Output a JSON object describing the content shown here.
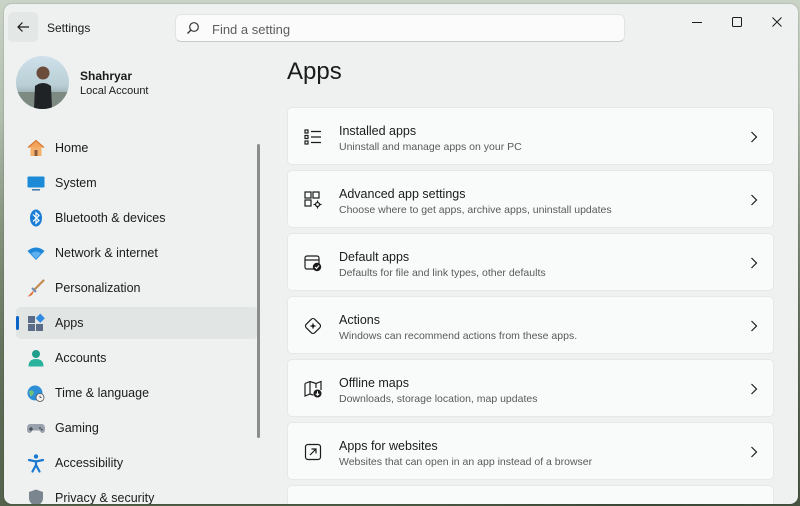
{
  "window": {
    "title": "Settings",
    "search_placeholder": "Find a setting",
    "controls": [
      "minimize-icon",
      "maximize-icon",
      "close-icon"
    ]
  },
  "user": {
    "name": "Shahryar",
    "account_type": "Local Account"
  },
  "sidebar": {
    "items": [
      {
        "label": "Home",
        "icon": "home-icon"
      },
      {
        "label": "System",
        "icon": "system-icon"
      },
      {
        "label": "Bluetooth & devices",
        "icon": "bluetooth-icon"
      },
      {
        "label": "Network & internet",
        "icon": "wifi-icon"
      },
      {
        "label": "Personalization",
        "icon": "brush-icon"
      },
      {
        "label": "Apps",
        "icon": "apps-icon",
        "active": true
      },
      {
        "label": "Accounts",
        "icon": "person-icon"
      },
      {
        "label": "Time & language",
        "icon": "globe-clock-icon"
      },
      {
        "label": "Gaming",
        "icon": "gamepad-icon"
      },
      {
        "label": "Accessibility",
        "icon": "accessibility-icon"
      },
      {
        "label": "Privacy & security",
        "icon": "shield-icon"
      }
    ]
  },
  "main": {
    "title": "Apps",
    "cards": [
      {
        "title": "Installed apps",
        "subtitle": "Uninstall and manage apps on your PC",
        "icon": "list-icon"
      },
      {
        "title": "Advanced app settings",
        "subtitle": "Choose where to get apps, archive apps, uninstall updates",
        "icon": "app-settings-icon"
      },
      {
        "title": "Default apps",
        "subtitle": "Defaults for file and link types, other defaults",
        "icon": "default-apps-icon"
      },
      {
        "title": "Actions",
        "subtitle": "Windows can recommend actions from these apps.",
        "icon": "actions-icon"
      },
      {
        "title": "Offline maps",
        "subtitle": "Downloads, storage location, map updates",
        "icon": "map-icon"
      },
      {
        "title": "Apps for websites",
        "subtitle": "Websites that can open in an app instead of a browser",
        "icon": "open-link-icon"
      }
    ]
  },
  "colors": {
    "accent": "#0a64c8",
    "window_bg": "#eef1f0",
    "card_bg": "#f9fafa"
  }
}
